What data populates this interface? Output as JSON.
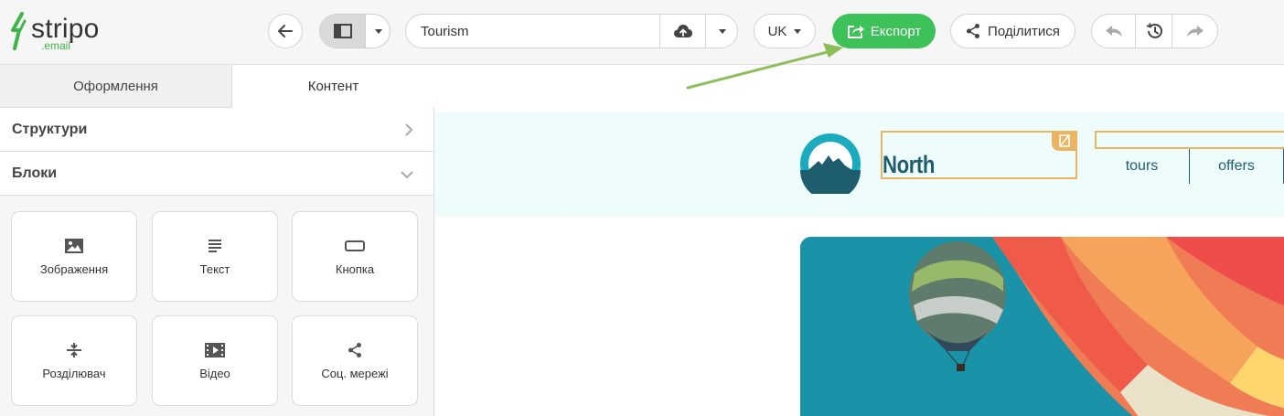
{
  "app": {
    "logo_word": "stripo",
    "logo_sub": ".email"
  },
  "toolbar": {
    "template_name": "Tourism",
    "language": "UK",
    "export_label": "Експорт",
    "share_label": "Поділитися"
  },
  "panel": {
    "tabs": [
      {
        "label": "Оформлення"
      },
      {
        "label": "Контент"
      }
    ],
    "sections": [
      {
        "label": "Структури"
      },
      {
        "label": "Блоки"
      }
    ],
    "blocks": [
      {
        "label": "Зображення",
        "icon": "image-icon"
      },
      {
        "label": "Текст",
        "icon": "text-icon"
      },
      {
        "label": "Кнопка",
        "icon": "button-icon"
      },
      {
        "label": "Розділювач",
        "icon": "spacer-icon"
      },
      {
        "label": "Відео",
        "icon": "video-icon"
      },
      {
        "label": "Соц. мережі",
        "icon": "share-icon"
      }
    ]
  },
  "email": {
    "brand": "North",
    "menu": [
      {
        "label": "tours"
      },
      {
        "label": "offers"
      }
    ]
  },
  "colors": {
    "accent_green": "#3cc258",
    "brand_teal": "#1d5d6e",
    "selection_orange": "#e9b562",
    "annotation_arrow": "#8cbf5a"
  }
}
